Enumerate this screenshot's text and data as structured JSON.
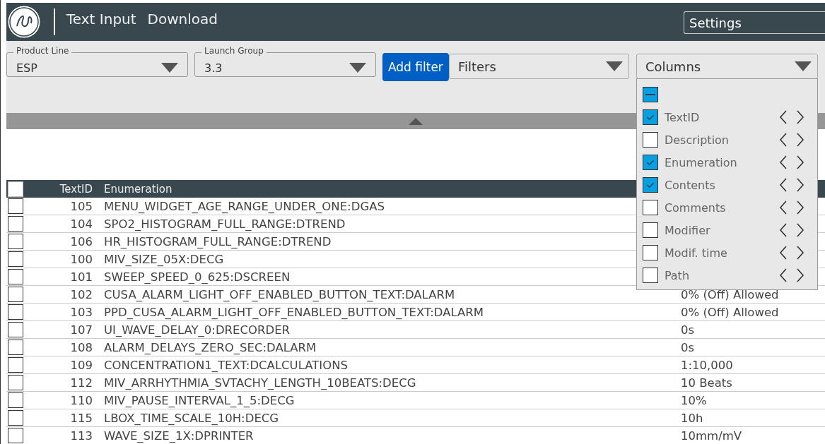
{
  "header": {
    "nav": [
      {
        "label": "Text Input"
      },
      {
        "label": "Download"
      }
    ],
    "settings": "Settings"
  },
  "filters": {
    "selects": [
      {
        "label": "Product Line",
        "value": "ESP"
      },
      {
        "label": "Launch Group",
        "value": "3.3"
      }
    ],
    "add_filter": "Add filter",
    "filters_select": "Filters",
    "columns_select": {
      "value": "Columns",
      "expanded": true,
      "select_all": {
        "indeterminate": true
      },
      "items": [
        {
          "label": "TextID",
          "checked": true
        },
        {
          "label": "Description",
          "checked": false
        },
        {
          "label": "Enumeration",
          "checked": true
        },
        {
          "label": "Contents",
          "checked": true
        },
        {
          "label": "Comments",
          "checked": false
        },
        {
          "label": "Modifier",
          "checked": false
        },
        {
          "label": "Modif. time",
          "checked": false
        },
        {
          "label": "Path",
          "checked": false
        }
      ]
    }
  },
  "table": {
    "columns": [
      "TextID",
      "Enumeration"
    ],
    "all_checked": false,
    "rows": [
      {
        "text_id": "105",
        "enumeration": "MENU_WIDGET_AGE_RANGE_UNDER_ONE:DGAS",
        "checked": false
      },
      {
        "text_id": "104",
        "enumeration": "SPO2_HISTOGRAM_FULL_RANGE:DTREND",
        "checked": false
      },
      {
        "text_id": "106",
        "enumeration": "HR_HISTOGRAM_FULL_RANGE:DTREND",
        "checked": false
      },
      {
        "text_id": "100",
        "enumeration": "MIV_SIZE_05X:DECG",
        "checked": false
      },
      {
        "text_id": "101",
        "enumeration": "SWEEP_SPEED_0_625:DSCREEN",
        "checked": false
      },
      {
        "text_id": "102",
        "enumeration": "CUSA_ALARM_LIGHT_OFF_ENABLED_BUTTON_TEXT:DALARM",
        "contents": "0% (Off) Allowed",
        "checked": false
      },
      {
        "text_id": "103",
        "enumeration": "PPD_CUSA_ALARM_LIGHT_OFF_ENABLED_BUTTON_TEXT:DALARM",
        "contents": "0% (Off) Allowed",
        "checked": false
      },
      {
        "text_id": "107",
        "enumeration": "UI_WAVE_DELAY_0:DRECORDER",
        "contents": "0s",
        "checked": false
      },
      {
        "text_id": "108",
        "enumeration": "ALARM_DELAYS_ZERO_SEC:DALARM",
        "contents": "0s",
        "checked": false
      },
      {
        "text_id": "109",
        "enumeration": "CONCENTRATION1_TEXT:DCALCULATIONS",
        "contents": "1:10,000",
        "checked": false
      },
      {
        "text_id": "112",
        "enumeration": "MIV_ARRHYTHMIA_SVTACHY_LENGTH_10BEATS:DECG",
        "contents": "10 Beats",
        "checked": false
      },
      {
        "text_id": "110",
        "enumeration": "MIV_PAUSE_INTERVAL_1_5:DECG",
        "contents": "10%",
        "checked": false
      },
      {
        "text_id": "115",
        "enumeration": "LBOX_TIME_SCALE_10H:DECG",
        "contents": "10h",
        "checked": false
      },
      {
        "text_id": "113",
        "enumeration": "WAVE_SIZE_1X:DPRINTER",
        "contents": "10mm/mV",
        "checked": false
      }
    ]
  }
}
